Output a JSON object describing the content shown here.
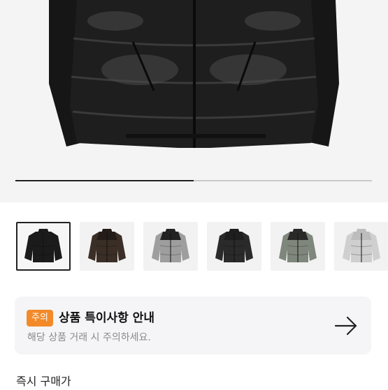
{
  "gallery": {
    "current_image": "black-puffer-jacket",
    "progress_fraction": 0.5
  },
  "thumbnails": [
    {
      "name": "black-glossy",
      "body": "#1b1b1b",
      "yoke": "#1b1b1b",
      "selected": true
    },
    {
      "name": "dark-brown",
      "body": "#3a2e27",
      "yoke": "#241c18",
      "selected": false
    },
    {
      "name": "grey-black",
      "body": "#9e9e9e",
      "yoke": "#222222",
      "selected": false
    },
    {
      "name": "matte-black",
      "body": "#2a2a2a",
      "yoke": "#1e1e1e",
      "selected": false
    },
    {
      "name": "olive-grey",
      "body": "#7f867c",
      "yoke": "#2a2a2a",
      "selected": false
    },
    {
      "name": "silver",
      "body": "#cfcfcf",
      "yoke": "#bdbdbd",
      "selected": false
    }
  ],
  "notice": {
    "badge": "주의",
    "title": "상품 특이사항 안내",
    "subtitle": "해당 상품 거래 시 주의하세요.",
    "arrow_icon": "arrow-right-icon"
  },
  "price": {
    "label": "즉시 구매가"
  },
  "colors": {
    "badge": "#f28a2a",
    "notice_bg": "#f5f5f7"
  }
}
